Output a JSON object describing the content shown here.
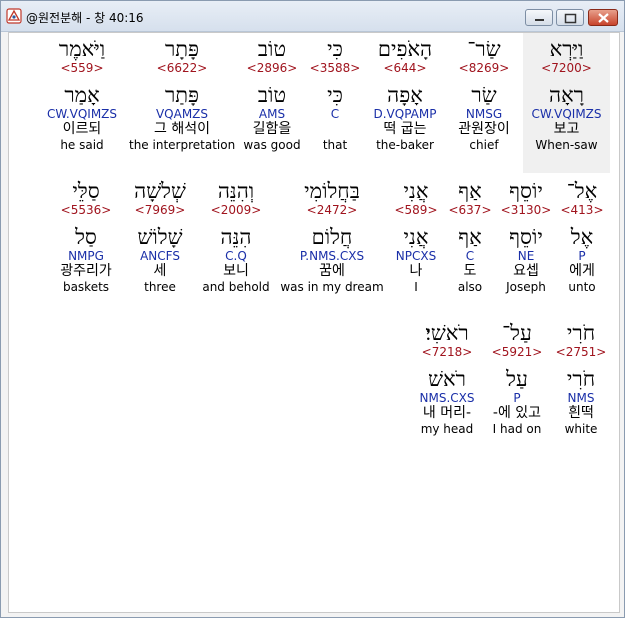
{
  "window": {
    "title": "@원전분해 - 창 40:16",
    "app_icon": "app-icon",
    "controls": [
      "minimize-icon",
      "maximize-icon",
      "close-icon"
    ]
  },
  "rows": [
    [
      {
        "heb": "וַיַּרְא",
        "num": "<7200>",
        "lemma": "רָאָה",
        "parse": "CW.VQIMZS",
        "ko": "보고",
        "en": "When-saw"
      },
      {
        "heb": "שַׂר־",
        "num": "<8269>",
        "lemma": "שַׂר",
        "parse": "NMSG",
        "ko": "관원장이",
        "en": "chief"
      },
      {
        "heb": "הָאֹפִים",
        "num": "<644>",
        "lemma": "אָפָה",
        "parse": "D.VQPAMP",
        "ko": "떡 굽는",
        "en": "the-baker"
      },
      {
        "heb": "כִּי",
        "num": "<3588>",
        "lemma": "כִּי",
        "parse": "C",
        "ko": "",
        "en": "that"
      },
      {
        "heb": "טוֹב",
        "num": "<2896>",
        "lemma": "טוֹב",
        "parse": "AMS",
        "ko": "길함을",
        "en": "was good"
      },
      {
        "heb": "פָּתָר",
        "num": "<6622>",
        "lemma": "פָּתַר",
        "parse": "VQAMZS",
        "ko": "그 해석이",
        "en": "the interpretation"
      },
      {
        "heb": "וַיֹּאמֶר",
        "num": "<559>",
        "lemma": "אָמַר",
        "parse": "CW.VQIMZS",
        "ko": "이르되",
        "en": "he said"
      }
    ],
    [
      {
        "heb": "אֶל־",
        "num": "<413>",
        "lemma": "אֶל",
        "parse": "P",
        "ko": "에게",
        "en": "unto"
      },
      {
        "heb": "יוֹסֵף",
        "num": "<3130>",
        "lemma": "יוֹסֵף",
        "parse": "NE",
        "ko": "요셉",
        "en": "Joseph"
      },
      {
        "heb": "אַף",
        "num": "<637>",
        "lemma": "אַף",
        "parse": "C",
        "ko": "도",
        "en": "also"
      },
      {
        "heb": "אֲנִי",
        "num": "<589>",
        "lemma": "אֲנִי",
        "parse": "NPCXS",
        "ko": "나",
        "en": "I"
      },
      {
        "heb": "בַּחֲלוֹמִי",
        "num": "<2472>",
        "lemma": "חֲלוֹם",
        "parse": "P.NMS.CXS",
        "ko": "꿈에",
        "en": "was in my dream"
      },
      {
        "heb": "וְהִנֵּה",
        "num": "<2009>",
        "lemma": "הִנֵּה",
        "parse": "C.Q",
        "ko": "보니",
        "en": "and behold"
      },
      {
        "heb": "שְׁלֹשָׁה",
        "num": "<7969>",
        "lemma": "שָׁלוֹשׁ",
        "parse": "ANCFS",
        "ko": "세",
        "en": "three"
      },
      {
        "heb": "סַלֵּי",
        "num": "<5536>",
        "lemma": "סַל",
        "parse": "NMPG",
        "ko": "광주리가",
        "en": "baskets"
      }
    ],
    [
      {
        "heb": "חֹרִי",
        "num": "<2751>",
        "lemma": "חֹרִי",
        "parse": "NMS",
        "ko": "흰떡",
        "en": "white"
      },
      {
        "heb": "עַל־",
        "num": "<5921>",
        "lemma": "עַל",
        "parse": "P",
        "ko": "-에 있고",
        "en": "I had on"
      },
      {
        "heb": "רֹאשִׁי׃",
        "num": "<7218>",
        "lemma": "רֹאשׁ",
        "parse": "NMS.CXS",
        "ko": "내 머리-",
        "en": "my head"
      }
    ]
  ]
}
